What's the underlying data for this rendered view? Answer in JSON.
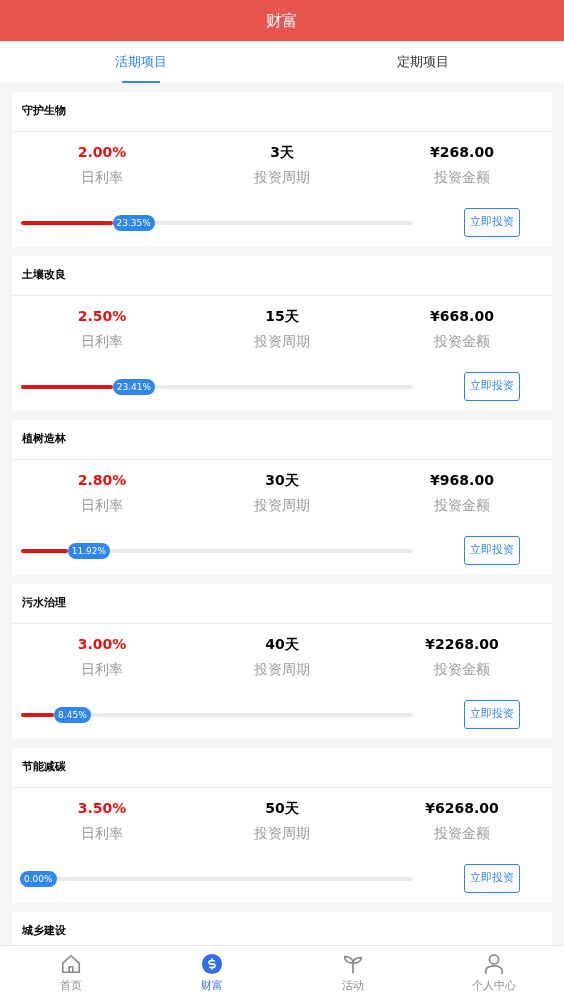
{
  "header": {
    "title": "财富"
  },
  "tabs": [
    {
      "label": "活期项目",
      "selected": true
    },
    {
      "label": "定期项目",
      "selected": false
    }
  ],
  "projects": [
    {
      "title": "守护生物",
      "rate": "2.00%",
      "rate_label": "日利率",
      "period": "3天",
      "period_label": "投资周期",
      "amount": "¥268.00",
      "amount_label": "投资金额",
      "level": 0.2335,
      "progress": "23.35%",
      "button": "立即投资"
    },
    {
      "title": "土壤改良",
      "rate": "2.50%",
      "rate_label": "日利率",
      "period": "15天",
      "period_label": "投资周期",
      "amount": "¥668.00",
      "amount_label": "投资金额",
      "level": 0.2341,
      "progress": "23.41%",
      "button": "立即投资"
    },
    {
      "title": "植树造林",
      "rate": "2.80%",
      "rate_label": "日利率",
      "period": "30天",
      "period_label": "投资周期",
      "amount": "¥968.00",
      "amount_label": "投资金额",
      "level": 0.1192,
      "progress": "11.92%",
      "button": "立即投资"
    },
    {
      "title": "污水治理",
      "rate": "3.00%",
      "rate_label": "日利率",
      "period": "40天",
      "period_label": "投资周期",
      "amount": "¥2268.00",
      "amount_label": "投资金额",
      "level": 0.0845,
      "progress": "8.45%",
      "button": "立即投资"
    },
    {
      "title": "节能减碳",
      "rate": "3.50%",
      "rate_label": "日利率",
      "period": "50天",
      "period_label": "投资周期",
      "amount": "¥6268.00",
      "amount_label": "投资金额",
      "level": 0,
      "progress": "0.00%",
      "button": "立即投资"
    },
    {
      "title": "城乡建设"
    }
  ],
  "nav": [
    {
      "kind": "home",
      "label": "首页",
      "selected": false
    },
    {
      "kind": "money",
      "label": "财富",
      "selected": true
    },
    {
      "kind": "sprout",
      "label": "活动",
      "selected": false
    },
    {
      "kind": "user",
      "label": "个人中心",
      "selected": false
    }
  ]
}
